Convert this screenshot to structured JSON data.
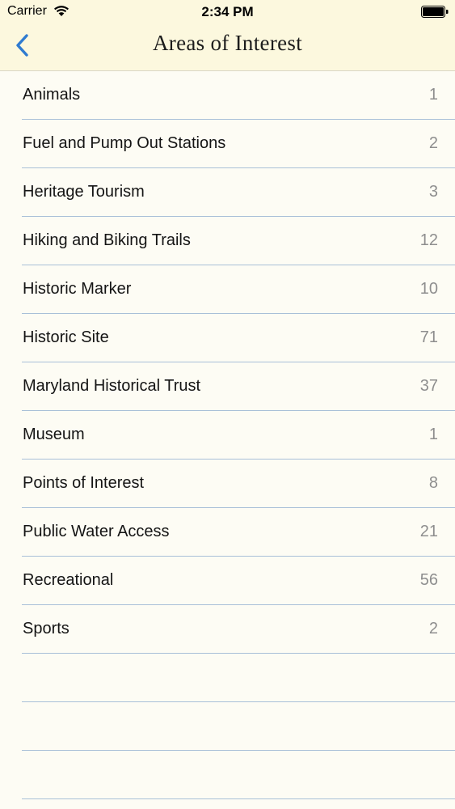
{
  "status_bar": {
    "carrier": "Carrier",
    "time": "2:34 PM"
  },
  "nav": {
    "title": "Areas of Interest",
    "back_icon": "chevron-left-icon",
    "accent_color": "#2f7bd0"
  },
  "colors": {
    "header_background": "#fcf8de",
    "list_background": "#fdfcf4",
    "separator": "#a9c0d8",
    "count_text": "#8e8e8e"
  },
  "categories": [
    {
      "label": "Animals",
      "count": "1"
    },
    {
      "label": "Fuel and Pump Out Stations",
      "count": "2"
    },
    {
      "label": "Heritage Tourism",
      "count": "3"
    },
    {
      "label": "Hiking and Biking Trails",
      "count": "12"
    },
    {
      "label": "Historic Marker",
      "count": "10"
    },
    {
      "label": "Historic Site",
      "count": "71"
    },
    {
      "label": "Maryland Historical Trust",
      "count": "37"
    },
    {
      "label": "Museum",
      "count": "1"
    },
    {
      "label": "Points of Interest",
      "count": "8"
    },
    {
      "label": "Public Water Access",
      "count": "21"
    },
    {
      "label": "Recreational",
      "count": "56"
    },
    {
      "label": "Sports",
      "count": "2"
    }
  ]
}
